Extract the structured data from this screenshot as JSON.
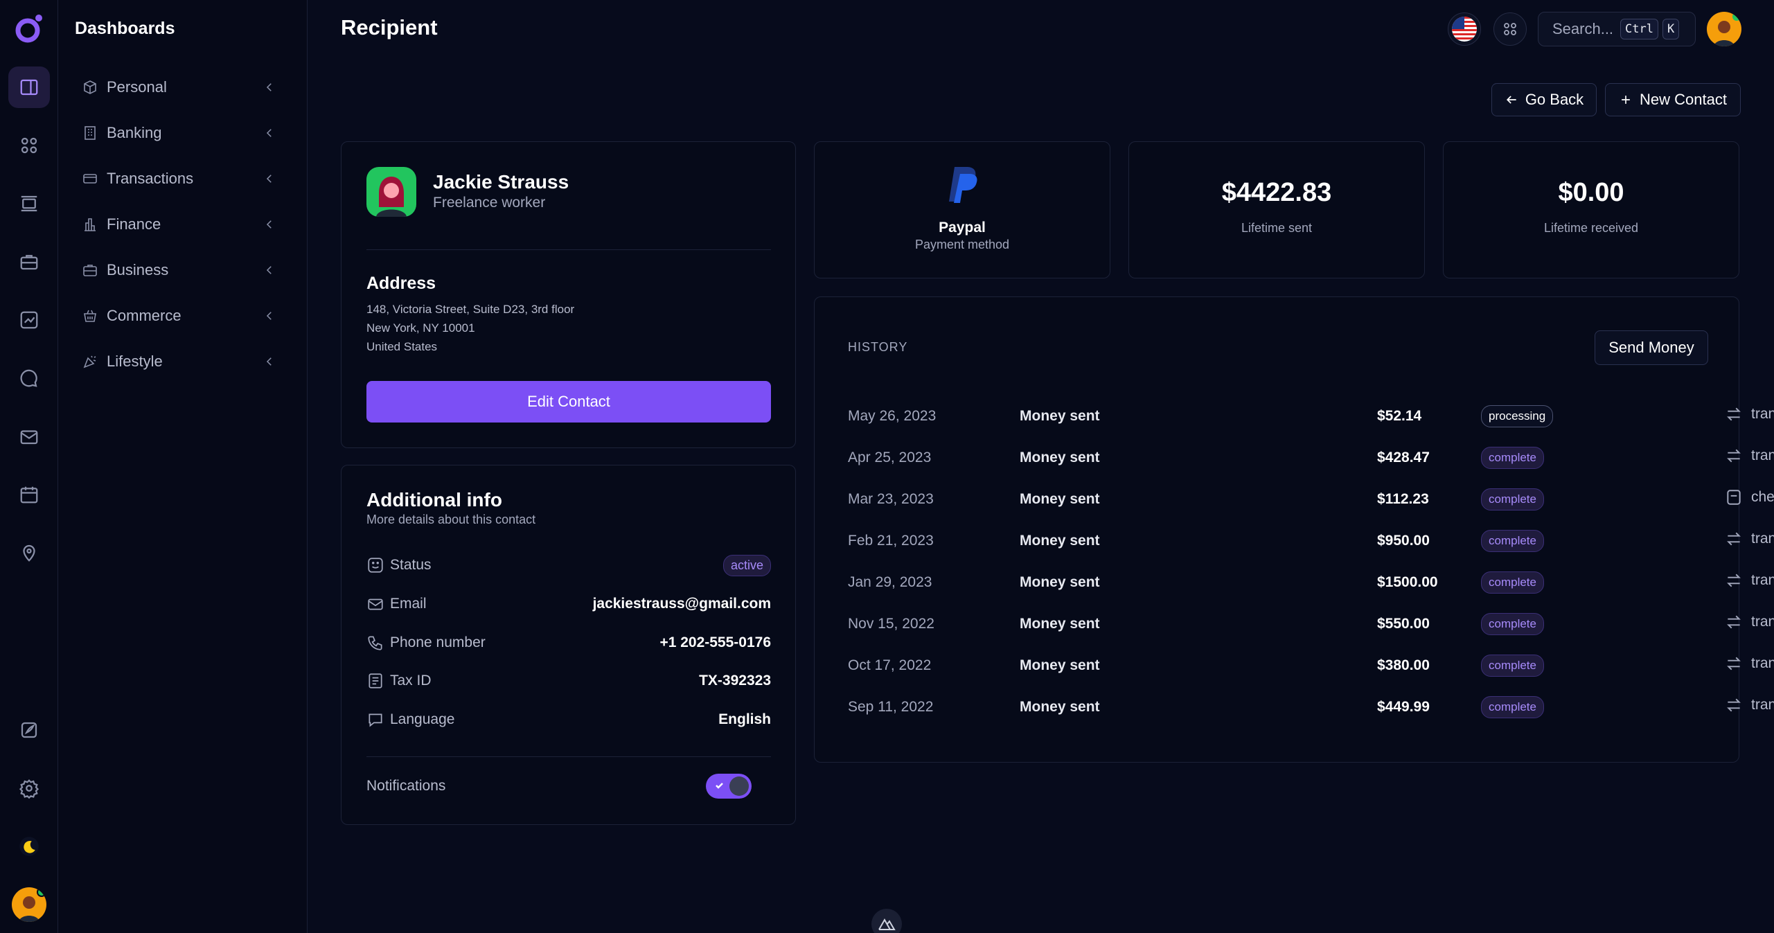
{
  "app": {
    "section_title": "Dashboards",
    "page_title": "Recipient"
  },
  "menu": {
    "items": [
      {
        "label": "Personal",
        "icon": "cube-icon"
      },
      {
        "label": "Banking",
        "icon": "building-icon"
      },
      {
        "label": "Transactions",
        "icon": "card-icon"
      },
      {
        "label": "Finance",
        "icon": "chart-icon"
      },
      {
        "label": "Business",
        "icon": "briefcase-icon"
      },
      {
        "label": "Commerce",
        "icon": "basket-icon"
      },
      {
        "label": "Lifestyle",
        "icon": "party-icon"
      }
    ]
  },
  "search": {
    "placeholder": "Search...",
    "shortcut_mod": "Ctrl",
    "shortcut_key": "K"
  },
  "actions": {
    "go_back": "Go Back",
    "new_contact": "New Contact"
  },
  "contact": {
    "name": "Jackie Strauss",
    "role": "Freelance worker",
    "address_title": "Address",
    "address_lines": [
      "148, Victoria Street, Suite D23, 3rd floor",
      "New York, NY 10001",
      "United States"
    ],
    "edit_label": "Edit Contact"
  },
  "additional": {
    "title": "Additional info",
    "subtitle": "More details about this contact",
    "status_label": "Status",
    "status_value": "active",
    "email_label": "Email",
    "email_value": "jackiestrauss@gmail.com",
    "phone_label": "Phone number",
    "phone_value": "+1 202-555-0176",
    "tax_label": "Tax ID",
    "tax_value": "TX-392323",
    "language_label": "Language",
    "language_value": "English",
    "notifications_label": "Notifications",
    "notifications_on": true
  },
  "stats": {
    "payment_name": "Paypal",
    "payment_sub": "Payment method",
    "sent_value": "$4422.83",
    "sent_label": "Lifetime sent",
    "received_value": "$0.00",
    "received_label": "Lifetime received"
  },
  "history": {
    "title": "HISTORY",
    "send_money": "Send Money",
    "rows": [
      {
        "date": "May 26, 2023",
        "desc": "Money sent",
        "amount": "$52.14",
        "status": "processing",
        "method": "transfer"
      },
      {
        "date": "Apr 25, 2023",
        "desc": "Money sent",
        "amount": "$428.47",
        "status": "complete",
        "method": "transfer"
      },
      {
        "date": "Mar 23, 2023",
        "desc": "Money sent",
        "amount": "$112.23",
        "status": "complete",
        "method": "cheque"
      },
      {
        "date": "Feb 21, 2023",
        "desc": "Money sent",
        "amount": "$950.00",
        "status": "complete",
        "method": "transfer"
      },
      {
        "date": "Jan 29, 2023",
        "desc": "Money sent",
        "amount": "$1500.00",
        "status": "complete",
        "method": "transfer"
      },
      {
        "date": "Nov 15, 2022",
        "desc": "Money sent",
        "amount": "$550.00",
        "status": "complete",
        "method": "transfer"
      },
      {
        "date": "Oct 17, 2022",
        "desc": "Money sent",
        "amount": "$380.00",
        "status": "complete",
        "method": "transfer"
      },
      {
        "date": "Sep 11, 2022",
        "desc": "Money sent",
        "amount": "$449.99",
        "status": "complete",
        "method": "transfer"
      }
    ]
  },
  "colors": {
    "accent": "#7c4ff5",
    "accent_light": "#a78bfa",
    "background": "#070b1c",
    "card": "#060a19"
  }
}
